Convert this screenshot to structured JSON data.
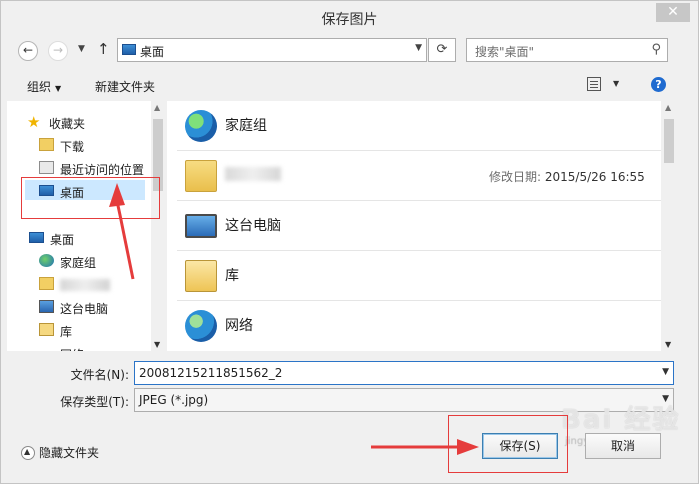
{
  "window": {
    "title": "保存图片",
    "close_glyph": "✕"
  },
  "nav": {
    "back": "←",
    "forward": "→",
    "up": "↑"
  },
  "address": {
    "location": "桌面"
  },
  "search": {
    "placeholder": "搜索\"桌面\""
  },
  "toolbar": {
    "organize": "组织",
    "new_folder": "新建文件夹",
    "help": "?"
  },
  "sidebar": {
    "items": [
      {
        "label": "收藏夹",
        "icon": "star-icon"
      },
      {
        "label": "下载",
        "icon": "download-folder-icon"
      },
      {
        "label": "最近访问的位置",
        "icon": "recent-places-icon"
      },
      {
        "label": "桌面",
        "icon": "desktop-icon",
        "selected": true
      },
      {
        "label": "桌面",
        "icon": "desktop-icon"
      },
      {
        "label": "家庭组",
        "icon": "homegroup-icon"
      },
      {
        "label": "",
        "icon": "user-folder-icon"
      },
      {
        "label": "这台电脑",
        "icon": "computer-icon"
      },
      {
        "label": "库",
        "icon": "library-icon"
      },
      {
        "label": "网络",
        "icon": "network-icon"
      }
    ]
  },
  "files": [
    {
      "name": "家庭组",
      "icon": "homegroup-icon"
    },
    {
      "name": "",
      "icon": "user-folder-icon",
      "modified_label": "修改日期:",
      "modified": "2015/5/26 16:55"
    },
    {
      "name": "这台电脑",
      "icon": "computer-icon"
    },
    {
      "name": "库",
      "icon": "library-icon"
    },
    {
      "name": "网络",
      "icon": "network-icon"
    }
  ],
  "form": {
    "filename_label": "文件名(N):",
    "filename_value": "20081215211851562_2",
    "filetype_label": "保存类型(T):",
    "filetype_value": "JPEG (*.jpg)"
  },
  "footer": {
    "hide_folders": "隐藏文件夹",
    "save": "保存(S)",
    "cancel": "取消"
  },
  "watermark": {
    "text": "Bai 经验",
    "sub": "jingyan.baidu.com"
  },
  "colors": {
    "annotation_red": "#e53c3c",
    "selection": "#cce8ff",
    "accent": "#2b74c7"
  }
}
